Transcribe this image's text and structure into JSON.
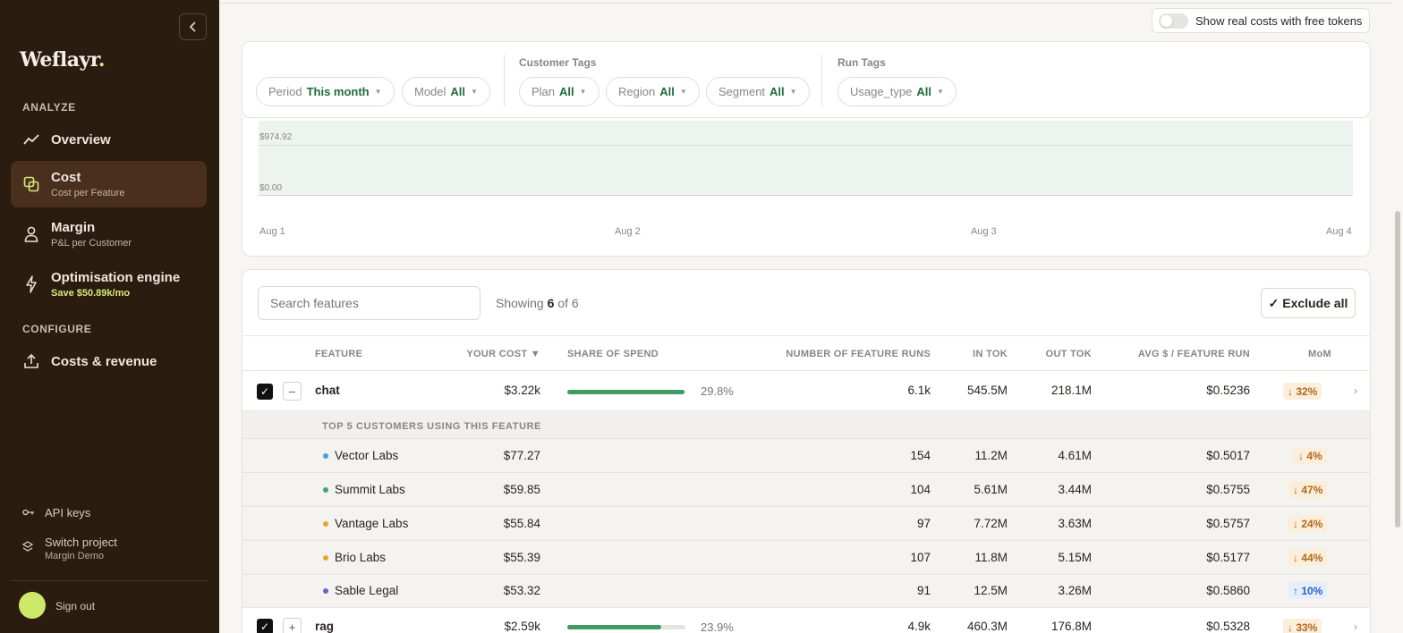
{
  "app": {
    "logo_text": "Weflayr",
    "logo_dot": ".",
    "collapse_icon": "chevron-left-icon"
  },
  "sidebar": {
    "analyze_label": "ANALYZE",
    "configure_label": "CONFIGURE",
    "items": [
      {
        "title": "Overview",
        "sub": "",
        "icon": "trend-line-icon"
      },
      {
        "title": "Cost",
        "sub": "Cost per Feature",
        "icon": "overlap-squares-icon"
      },
      {
        "title": "Margin",
        "sub": "P&L per Customer",
        "icon": "user-icon"
      },
      {
        "title": "Optimisation engine",
        "sub": "Save $50.89k/mo",
        "icon": "lightning-icon"
      },
      {
        "title": "Costs & revenue",
        "sub": "",
        "icon": "upload-icon"
      }
    ],
    "api_keys": "API keys",
    "switch_project": "Switch project",
    "project_name": "Margin Demo",
    "sign_out": "Sign out"
  },
  "toggle": {
    "label": "Show real costs with free tokens",
    "on": false
  },
  "filters": {
    "customer_tags_label": "Customer Tags",
    "run_tags_label": "Run Tags",
    "period": {
      "label": "Period",
      "value": "This month"
    },
    "model": {
      "label": "Model",
      "value": "All"
    },
    "plan": {
      "label": "Plan",
      "value": "All"
    },
    "region": {
      "label": "Region",
      "value": "All"
    },
    "segment": {
      "label": "Segment",
      "value": "All"
    },
    "usage_type": {
      "label": "Usage_type",
      "value": "All"
    }
  },
  "chart_data": {
    "type": "area",
    "x": [
      "Aug 1",
      "Aug 2",
      "Aug 3",
      "Aug 4"
    ],
    "y_ticks": [
      "$974.92",
      "$0.00"
    ],
    "ylim": [
      0,
      974.92
    ]
  },
  "table": {
    "search_placeholder": "Search features",
    "showing_prefix": "Showing",
    "showing_count": "6",
    "showing_suffix": "of 6",
    "exclude_all": "✓ Exclude all",
    "headers": {
      "feature": "FEATURE",
      "your_cost": "YOUR COST ▼",
      "share": "SHARE OF SPEND",
      "runs": "NUMBER OF FEATURE RUNS",
      "in_tok": "IN TOK",
      "out_tok": "OUT TOK",
      "avg": "AVG $ / FEATURE RUN",
      "mom": "MoM"
    },
    "rows": [
      {
        "name": "chat",
        "cost": "$3.22k",
        "share_pct": "29.8%",
        "share": 0.298,
        "runs": "6.1k",
        "in_tok": "545.5M",
        "out_tok": "218.1M",
        "avg": "$0.5236",
        "mom": "↓ 32%",
        "mom_dir": "down",
        "expand": "–"
      },
      {
        "name": "rag",
        "cost": "$2.59k",
        "share_pct": "23.9%",
        "share": 0.239,
        "runs": "4.9k",
        "in_tok": "460.3M",
        "out_tok": "176.8M",
        "avg": "$0.5328",
        "mom": "↓ 33%",
        "mom_dir": "down",
        "expand": "+"
      }
    ],
    "sub_header": "TOP 5 CUSTOMERS USING THIS FEATURE",
    "sub_rows": [
      {
        "name": "Vector Labs",
        "color": "#4a9fd0",
        "cost": "$77.27",
        "runs": "154",
        "in_tok": "11.2M",
        "out_tok": "4.61M",
        "avg": "$0.5017",
        "mom": "↓ 4%",
        "mom_dir": "down"
      },
      {
        "name": "Summit Labs",
        "color": "#3fa38a",
        "cost": "$59.85",
        "runs": "104",
        "in_tok": "5.61M",
        "out_tok": "3.44M",
        "avg": "$0.5755",
        "mom": "↓ 47%",
        "mom_dir": "down"
      },
      {
        "name": "Vantage Labs",
        "color": "#e0a92e",
        "cost": "$55.84",
        "runs": "97",
        "in_tok": "7.72M",
        "out_tok": "3.63M",
        "avg": "$0.5757",
        "mom": "↓ 24%",
        "mom_dir": "down"
      },
      {
        "name": "Brio Labs",
        "color": "#e0a92e",
        "cost": "$55.39",
        "runs": "107",
        "in_tok": "11.8M",
        "out_tok": "5.15M",
        "avg": "$0.5177",
        "mom": "↓ 44%",
        "mom_dir": "down"
      },
      {
        "name": "Sable Legal",
        "color": "#6b5fd6",
        "cost": "$53.32",
        "runs": "91",
        "in_tok": "12.5M",
        "out_tok": "3.26M",
        "avg": "$0.5860",
        "mom": "↑ 10%",
        "mom_dir": "up"
      }
    ]
  }
}
